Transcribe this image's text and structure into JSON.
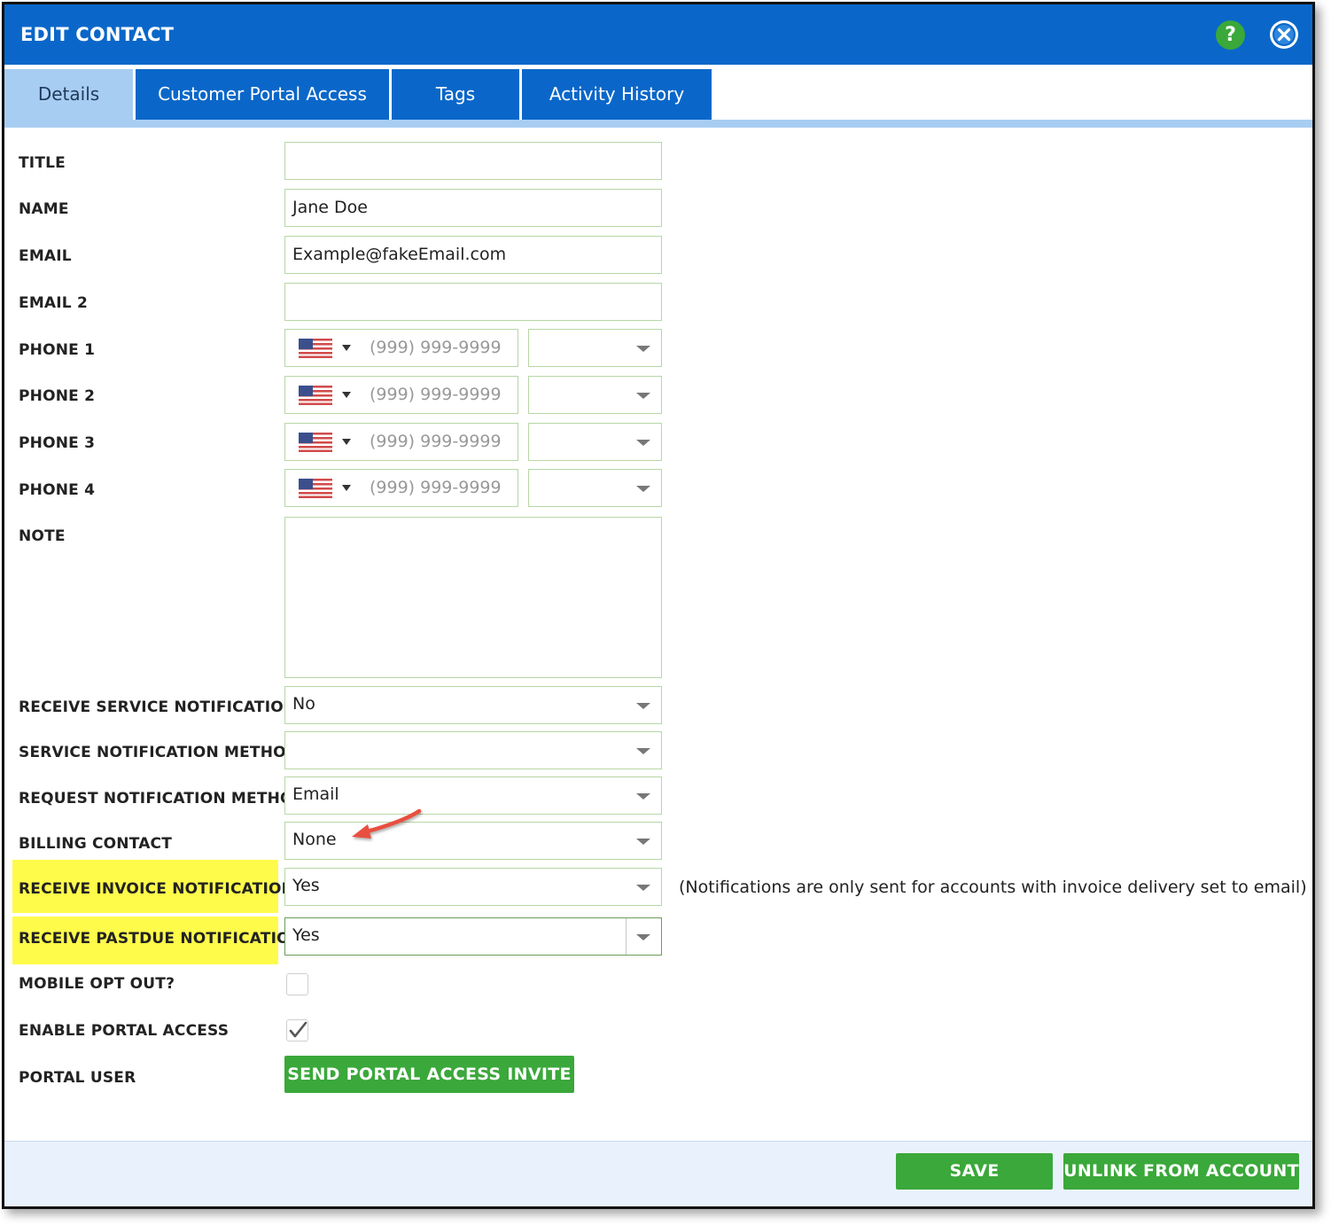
{
  "dialog": {
    "title": "EDIT CONTACT"
  },
  "tabs": [
    {
      "label": "Details",
      "active": true
    },
    {
      "label": "Customer Portal Access"
    },
    {
      "label": "Tags"
    },
    {
      "label": "Activity History"
    }
  ],
  "fields": {
    "title": {
      "label": "TITLE",
      "value": ""
    },
    "name": {
      "label": "NAME",
      "value": "Jane Doe"
    },
    "email": {
      "label": "EMAIL",
      "value": "Example@fakeEmail.com"
    },
    "email2": {
      "label": "EMAIL 2",
      "value": ""
    },
    "phones": [
      {
        "label": "PHONE 1",
        "placeholder": "(999) 999-9999",
        "type": ""
      },
      {
        "label": "PHONE 2",
        "placeholder": "(999) 999-9999",
        "type": ""
      },
      {
        "label": "PHONE 3",
        "placeholder": "(999) 999-9999",
        "type": ""
      },
      {
        "label": "PHONE 4",
        "placeholder": "(999) 999-9999",
        "type": ""
      }
    ],
    "note": {
      "label": "NOTE",
      "value": ""
    },
    "receive_service_notifications": {
      "label": "RECEIVE SERVICE NOTIFICATIONS",
      "value": "No"
    },
    "service_notification_method": {
      "label": "SERVICE NOTIFICATION METHOD",
      "value": ""
    },
    "request_notification_method": {
      "label": "REQUEST NOTIFICATION METHOD",
      "value": "Email"
    },
    "billing_contact": {
      "label": "BILLING CONTACT",
      "value": "None"
    },
    "receive_invoice_notifications": {
      "label": "RECEIVE INVOICE NOTIFICATIONS",
      "value": "Yes",
      "hint": "(Notifications are only sent for accounts with invoice delivery set to email)"
    },
    "receive_pastdue_notification": {
      "label": "RECEIVE PASTDUE NOTIFICATION",
      "value": "Yes"
    },
    "mobile_opt_out": {
      "label": "MOBILE OPT OUT?",
      "checked": false
    },
    "enable_portal_access": {
      "label": "ENABLE PORTAL ACCESS",
      "checked": true
    },
    "portal_user": {
      "label": "PORTAL USER",
      "button": "SEND PORTAL ACCESS INVITE"
    }
  },
  "footer": {
    "save": "SAVE",
    "unlink": "UNLINK FROM ACCOUNT"
  },
  "icons": {
    "help": "?",
    "help_icon": "help-icon",
    "close_icon": "close-icon",
    "flag_icon": "us-flag-icon"
  },
  "colors": {
    "header": "#0a67c9",
    "active_tab": "#a8cdf2",
    "accent_green": "#3aa83a",
    "highlight": "#fffb4a",
    "annotation_arrow": "#e8503f"
  }
}
